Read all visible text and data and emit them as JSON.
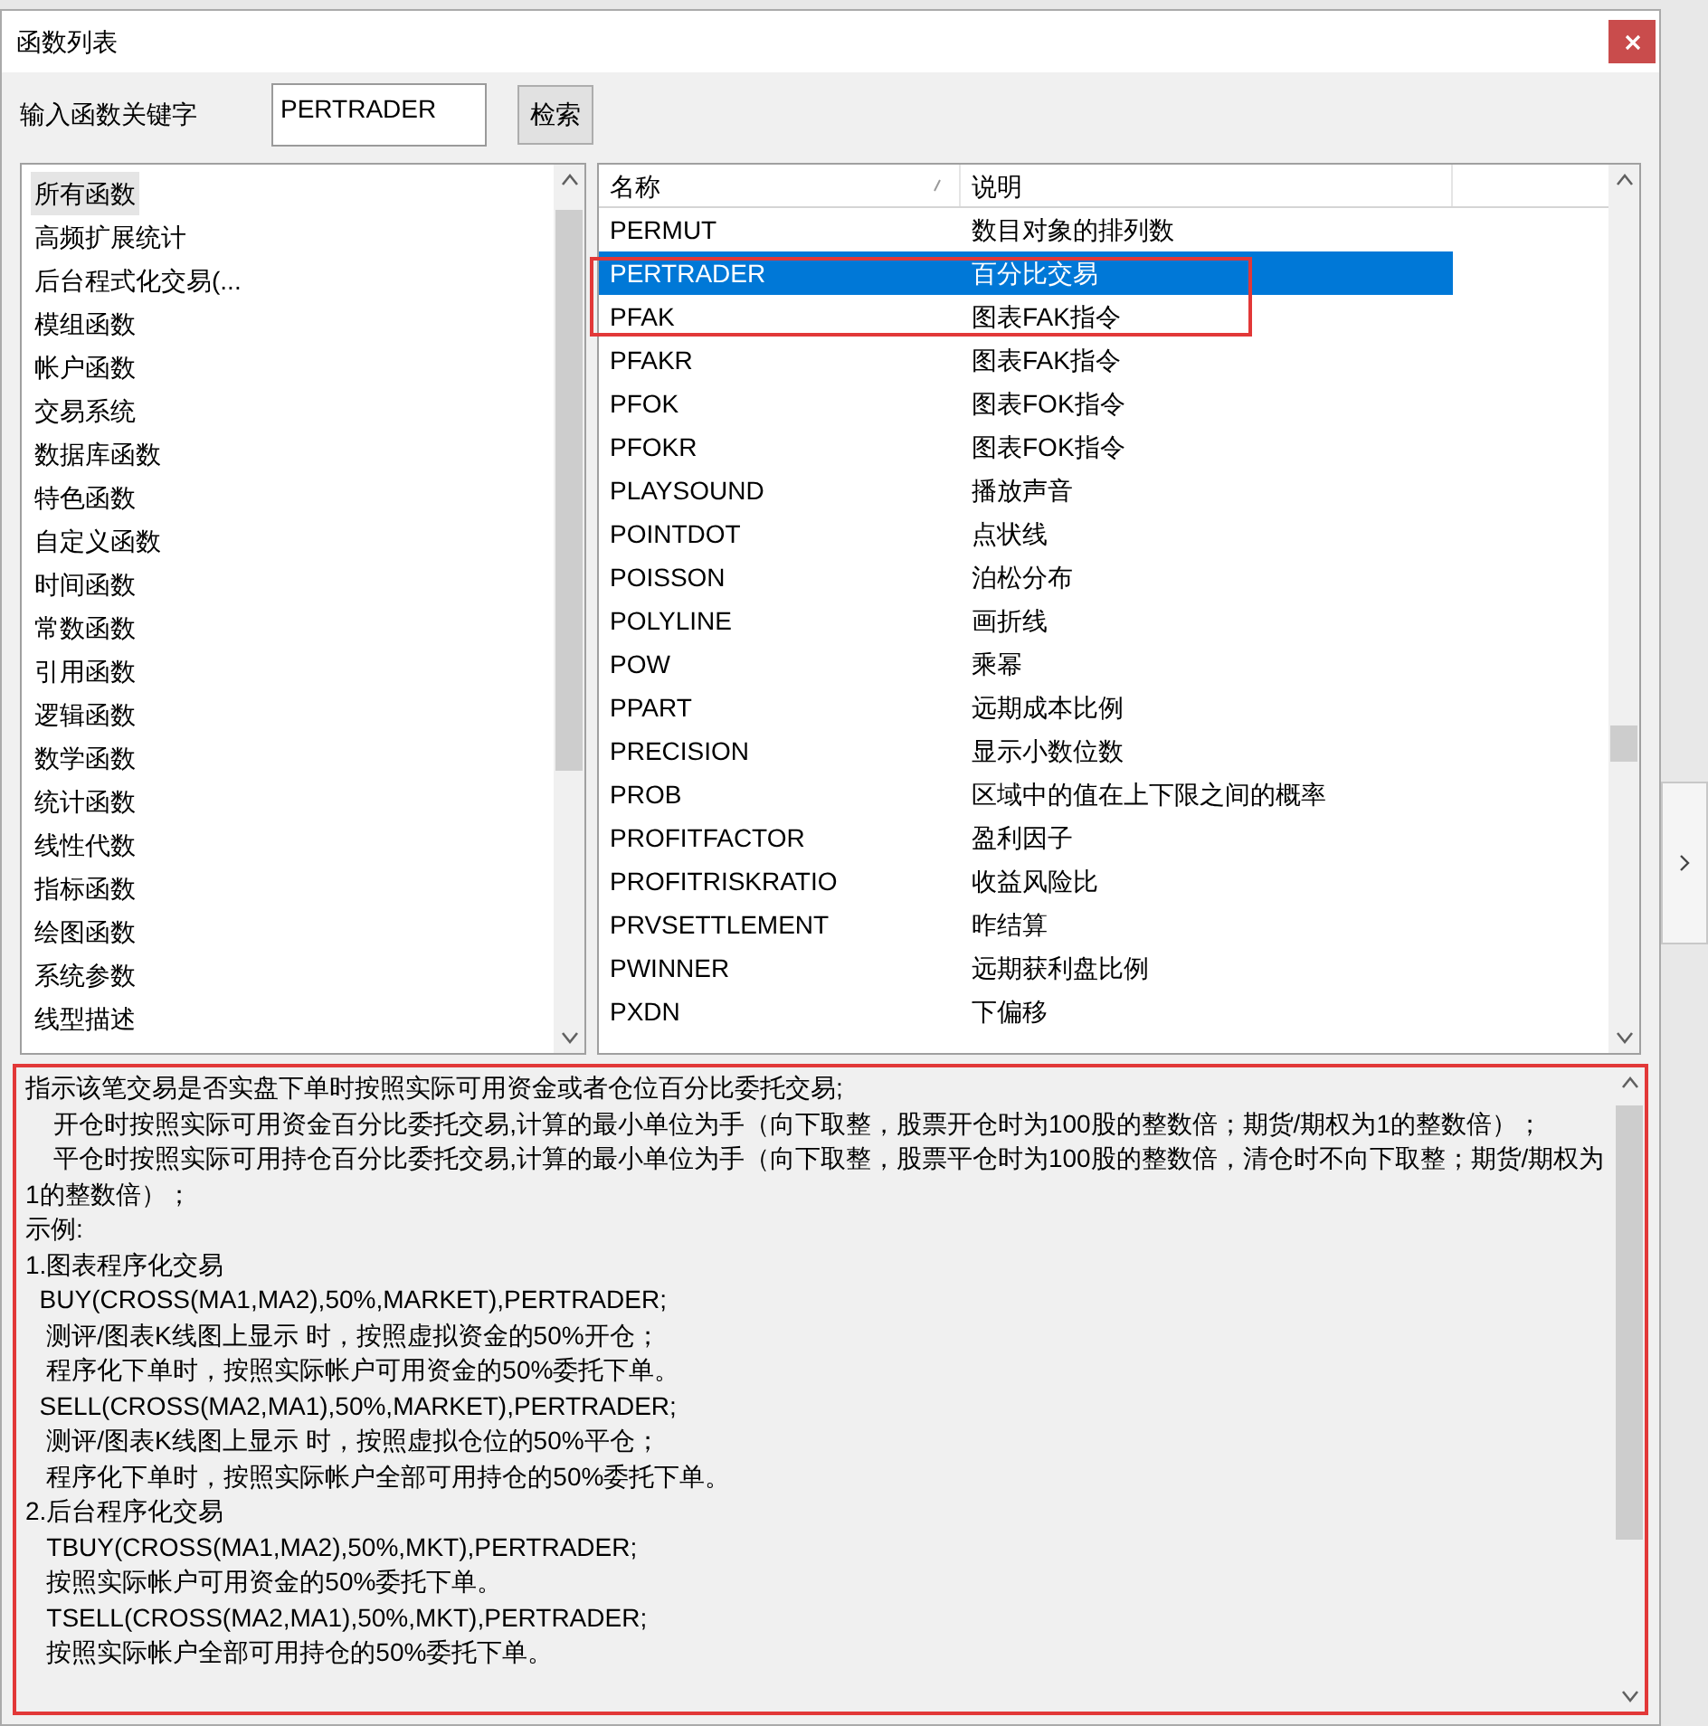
{
  "window": {
    "title": "函数列表"
  },
  "search": {
    "label": "输入函数关键字",
    "value": "PERTRADER",
    "button": "检索"
  },
  "categories": [
    {
      "label": "所有函数",
      "selected": true
    },
    {
      "label": "高频扩展统计",
      "selected": false
    },
    {
      "label": "后台程式化交易(...",
      "selected": false
    },
    {
      "label": "模组函数",
      "selected": false
    },
    {
      "label": "帐户函数",
      "selected": false
    },
    {
      "label": "交易系统",
      "selected": false
    },
    {
      "label": "数据库函数",
      "selected": false
    },
    {
      "label": "特色函数",
      "selected": false
    },
    {
      "label": "自定义函数",
      "selected": false
    },
    {
      "label": "时间函数",
      "selected": false
    },
    {
      "label": "常数函数",
      "selected": false
    },
    {
      "label": "引用函数",
      "selected": false
    },
    {
      "label": "逻辑函数",
      "selected": false
    },
    {
      "label": "数学函数",
      "selected": false
    },
    {
      "label": "统计函数",
      "selected": false
    },
    {
      "label": "线性代数",
      "selected": false
    },
    {
      "label": "指标函数",
      "selected": false
    },
    {
      "label": "绘图函数",
      "selected": false
    },
    {
      "label": "系统参数",
      "selected": false
    },
    {
      "label": "线型描述",
      "selected": false
    }
  ],
  "table": {
    "columns": [
      "名称",
      "说明"
    ],
    "rows": [
      {
        "name": "PERMUT",
        "desc": "数目对象的排列数",
        "selected": false
      },
      {
        "name": "PERTRADER",
        "desc": "百分比交易",
        "selected": true
      },
      {
        "name": "PFAK",
        "desc": "图表FAK指令",
        "selected": false
      },
      {
        "name": "PFAKR",
        "desc": "图表FAK指令",
        "selected": false
      },
      {
        "name": "PFOK",
        "desc": "图表FOK指令",
        "selected": false
      },
      {
        "name": "PFOKR",
        "desc": "图表FOK指令",
        "selected": false
      },
      {
        "name": "PLAYSOUND",
        "desc": "播放声音",
        "selected": false
      },
      {
        "name": "POINTDOT",
        "desc": "点状线",
        "selected": false
      },
      {
        "name": "POISSON",
        "desc": "泊松分布",
        "selected": false
      },
      {
        "name": "POLYLINE",
        "desc": "画折线",
        "selected": false
      },
      {
        "name": "POW",
        "desc": "乘幂",
        "selected": false
      },
      {
        "name": "PPART",
        "desc": "远期成本比例",
        "selected": false
      },
      {
        "name": "PRECISION",
        "desc": "显示小数位数",
        "selected": false
      },
      {
        "name": "PROB",
        "desc": "区域中的值在上下限之间的概率",
        "selected": false
      },
      {
        "name": "PROFITFACTOR",
        "desc": "盈利因子",
        "selected": false
      },
      {
        "name": "PROFITRISKRATIO",
        "desc": "收益风险比",
        "selected": false
      },
      {
        "name": "PRVSETTLEMENT",
        "desc": "昨结算",
        "selected": false
      },
      {
        "name": "PWINNER",
        "desc": "远期获利盘比例",
        "selected": false
      },
      {
        "name": "PXDN",
        "desc": "下偏移",
        "selected": false
      }
    ]
  },
  "description": [
    "指示该笔交易是否实盘下单时按照实际可用资金或者仓位百分比委托交易;",
    "    开仓时按照实际可用资金百分比委托交易,计算的最小单位为手（向下取整，股票开仓时为100股的整数倍；期货/期权为1的整数倍）；",
    "    平仓时按照实际可用持仓百分比委托交易,计算的最小单位为手（向下取整，股票平仓时为100股的整数倍，清仓时不向下取整；期货/期权为1的整数倍）；",
    "示例:",
    "1.图表程序化交易",
    "  BUY(CROSS(MA1,MA2),50%,MARKET),PERTRADER;",
    "   测评/图表K线图上显示 时，按照虚拟资金的50%开仓；",
    "   程序化下单时，按照实际帐户可用资金的50%委托下单。",
    "  SELL(CROSS(MA2,MA1),50%,MARKET),PERTRADER;",
    "   测评/图表K线图上显示 时，按照虚拟仓位的50%平仓；",
    "   程序化下单时，按照实际帐户全部可用持仓的50%委托下单。",
    "2.后台程序化交易",
    "   TBUY(CROSS(MA1,MA2),50%,MKT),PERTRADER;",
    "   按照实际帐户可用资金的50%委托下单。",
    "   TSELL(CROSS(MA2,MA1),50%,MKT),PERTRADER;",
    "   按照实际帐户全部可用持仓的50%委托下单。"
  ]
}
